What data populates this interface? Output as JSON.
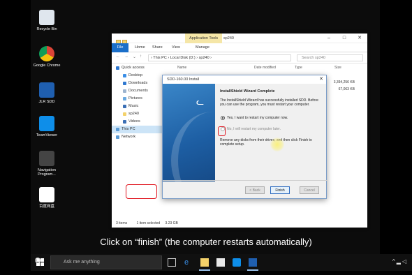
{
  "desktop": {
    "icons": [
      {
        "label": "Recycle Bin",
        "color": "#dfe6ee"
      },
      {
        "label": "Google Chrome",
        "color": "#db4437"
      },
      {
        "label": "JLR SDD",
        "color": "#1f5fb0"
      },
      {
        "label": "TeamViewer",
        "color": "#0e8ee9"
      },
      {
        "label": "Navigation Program...",
        "color": "#444444"
      },
      {
        "label": "百度网盘",
        "color": "#ffffff"
      }
    ]
  },
  "explorer": {
    "app_tools_label": "Application Tools",
    "title": "sp240",
    "ribbon_tabs": [
      "File",
      "Home",
      "Share",
      "View",
      "Manage"
    ],
    "address": "›  This PC  ›  Local Disk (D:)  ›  sp240  ›",
    "search_placeholder": "Search sp240",
    "columns": [
      "Name",
      "Date modified",
      "Type",
      "Size"
    ],
    "sizes": [
      "3,394,256 KB",
      "67,063 KB"
    ],
    "nav": {
      "quick_access": "Quick access",
      "items": [
        "Desktop",
        "Downloads",
        "Documents",
        "Pictures",
        "Music",
        "sp240",
        "Videos"
      ],
      "this_pc": "This PC",
      "network": "Network"
    },
    "status": {
      "items": "3 items",
      "selected": "1 item selected",
      "size": "3.23 GB"
    }
  },
  "dialog": {
    "title": "SDD-160.00 Install",
    "heading": "InstallShield Wizard Complete",
    "body": "The InstallShield Wizard has successfully installed SDD. Before you can use the program, you must restart your computer.",
    "option_yes": "Yes, I want to restart my computer now.",
    "option_no": "No, I will restart my computer later.",
    "footer_text": "Remove any disks from their drives, and then click Finish to complete setup.",
    "back_label": "< Back",
    "finish_label": "Finish",
    "cancel_label": "Cancel",
    "highlight_color": "#e0141e"
  },
  "caption": "Click on “finish” (the computer restarts automatically)",
  "taskbar": {
    "search_placeholder": "Ask me anything"
  }
}
